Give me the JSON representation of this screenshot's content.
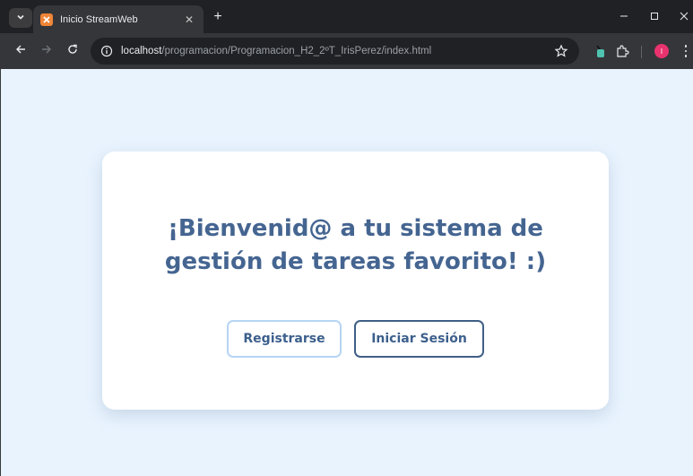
{
  "browser": {
    "tab": {
      "title": "Inicio StreamWeb",
      "close": "✕"
    },
    "new_tab": "+",
    "address": {
      "host": "localhost",
      "path": "/programacion/Programacion_H2_2ºT_IrisPerez/index.html"
    },
    "profile_initial": "I",
    "icons": {
      "tab_search": "chevron-down-icon",
      "favicon": "xampp-icon",
      "back": "arrow-left-icon",
      "forward": "arrow-right-icon",
      "reload": "reload-icon",
      "site_info": "info-icon",
      "bookmark": "star-icon",
      "extension_1": "extension-icon",
      "extensions": "puzzle-icon",
      "menu": "more-vert-icon",
      "minimize": "minimize-icon",
      "maximize": "maximize-icon",
      "close": "close-icon"
    }
  },
  "page": {
    "heading": "¡Bienvenid@ a tu sistema de gestión de tareas favorito! :)",
    "buttons": {
      "register": "Registrarse",
      "login": "Iniciar Sesión"
    }
  },
  "colors": {
    "background": "#e8f3fe",
    "heading": "#456591",
    "register_border": "#b6d4f5",
    "login_border": "#3f5f86",
    "avatar": "#e8336e"
  }
}
